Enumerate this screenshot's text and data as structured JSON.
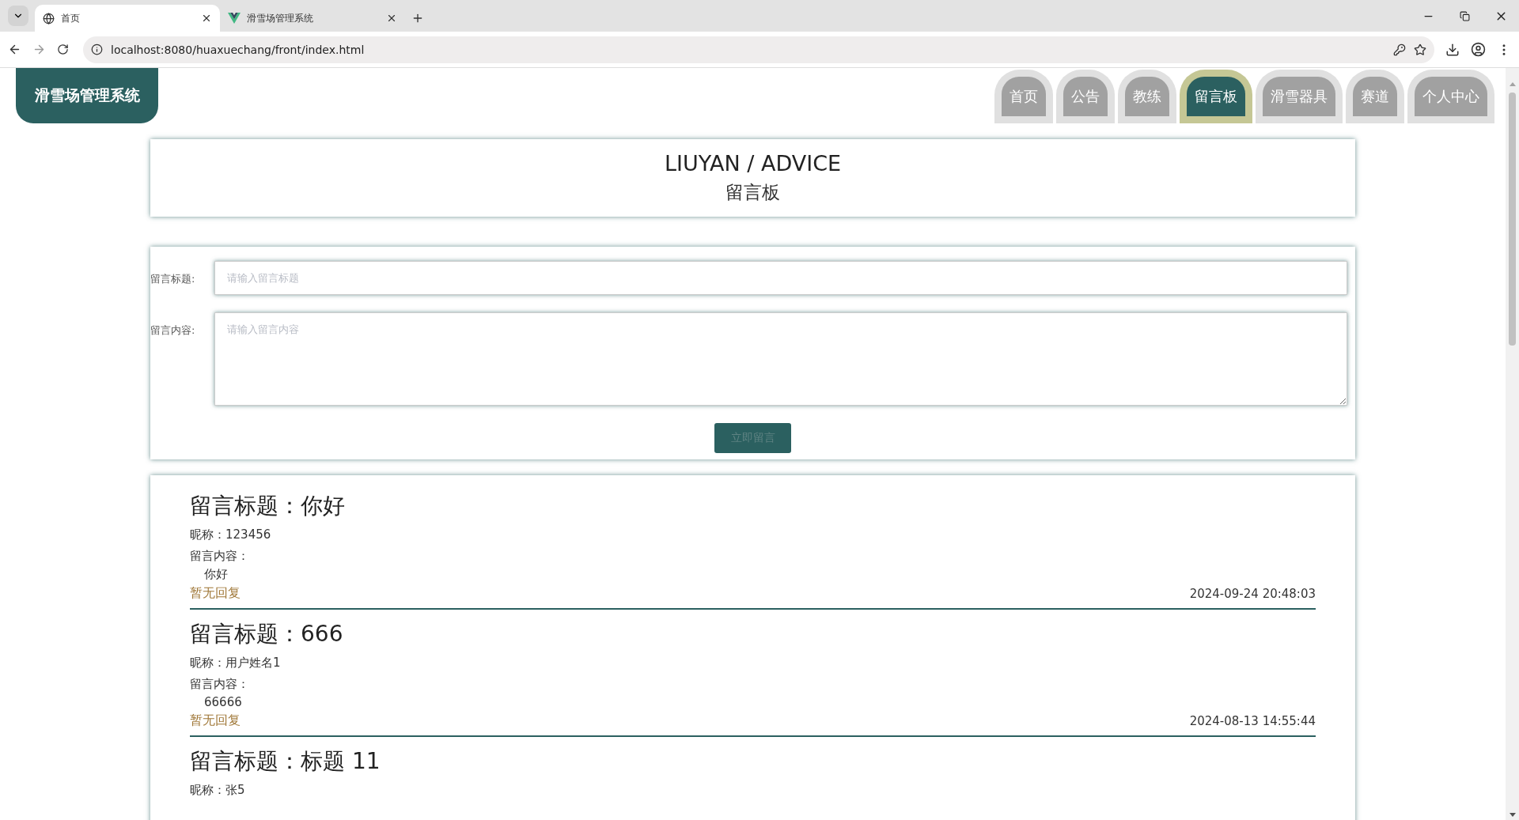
{
  "browser": {
    "tabs": [
      {
        "title": "首页",
        "kind": "globe",
        "selected": true
      },
      {
        "title": "滑雪场管理系统",
        "kind": "vue",
        "selected": false
      }
    ],
    "url": "localhost:8080/huaxuechang/front/index.html"
  },
  "logo": "滑雪场管理系统",
  "nav": [
    {
      "label": "首页",
      "selected": false
    },
    {
      "label": "公告",
      "selected": false
    },
    {
      "label": "教练",
      "selected": false
    },
    {
      "label": "留言板",
      "selected": true
    },
    {
      "label": "滑雪器具",
      "selected": false
    },
    {
      "label": "赛道",
      "selected": false
    },
    {
      "label": "个人中心",
      "selected": false
    }
  ],
  "header": {
    "title": "LIUYAN / ADVICE",
    "subtitle": "留言板"
  },
  "form": {
    "fields": [
      {
        "label": "留言标题:",
        "placeholder": "请输入留言标题",
        "kind": "input"
      },
      {
        "label": "留言内容:",
        "placeholder": "请输入留言内容",
        "kind": "textarea"
      }
    ],
    "submit": "立即留言"
  },
  "messages": [
    {
      "title": "留言标题：你好",
      "nickname": "昵称：123456",
      "content_label": "留言内容：",
      "content": "你好",
      "reply": "暂无回复",
      "time": "2024-09-24 20:48:03"
    },
    {
      "title": "留言标题：666",
      "nickname": "昵称：用户姓名1",
      "content_label": "留言内容：",
      "content": "66666",
      "reply": "暂无回复",
      "time": "2024-08-13 14:55:44"
    },
    {
      "title": "留言标题：标题 11",
      "nickname": "昵称：张5"
    }
  ]
}
